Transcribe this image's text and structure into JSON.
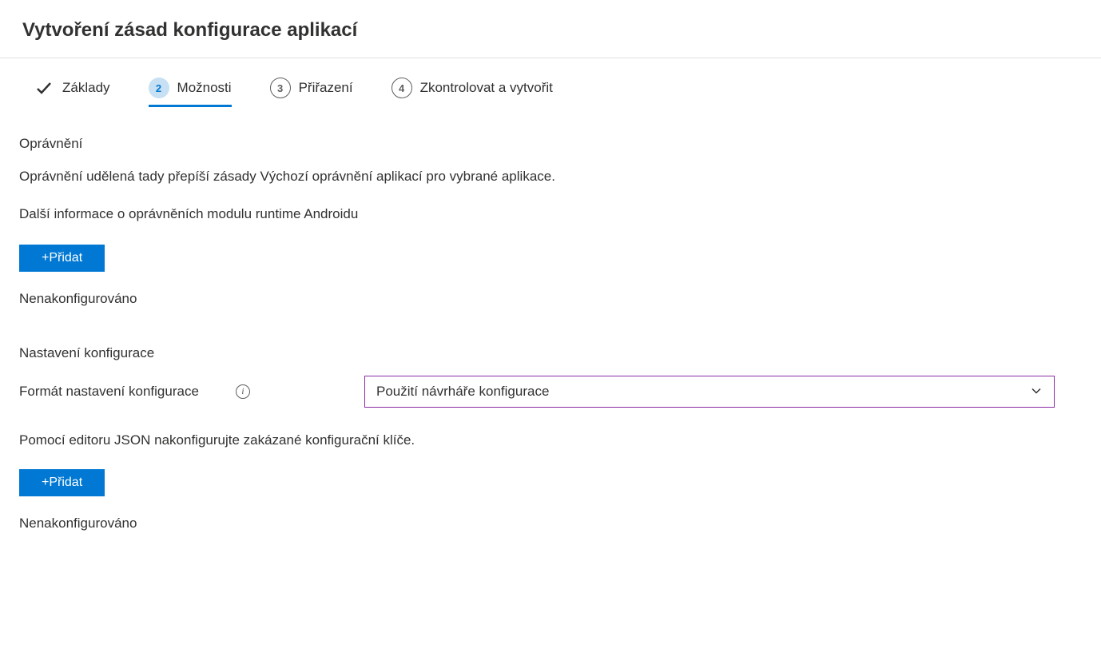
{
  "header": {
    "title": "Vytvoření zásad konfigurace aplikací"
  },
  "stepper": {
    "steps": [
      {
        "label": "Základy",
        "state": "completed"
      },
      {
        "number": "2",
        "label": "Možnosti",
        "state": "active"
      },
      {
        "number": "3",
        "label": "Přiřazení",
        "state": "pending"
      },
      {
        "number": "4",
        "label": "Zkontrolovat a vytvořit",
        "state": "pending"
      }
    ]
  },
  "permissions": {
    "title": "Oprávnění",
    "description": "Oprávnění udělená tady přepíší zásady Výchozí oprávnění aplikací pro vybrané aplikace.",
    "learn_more": "Další informace o oprávněních modulu runtime Androidu",
    "add_button": "+Přidat",
    "status": "Nenakonfigurováno"
  },
  "config_settings": {
    "title": "Nastavení konfigurace",
    "format_label": "Formát nastavení konfigurace",
    "format_value": "Použití návrháře konfigurace",
    "json_description": "Pomocí editoru JSON nakonfigurujte zakázané konfigurační klíče.",
    "add_button": "+Přidat",
    "status": "Nenakonfigurováno"
  }
}
